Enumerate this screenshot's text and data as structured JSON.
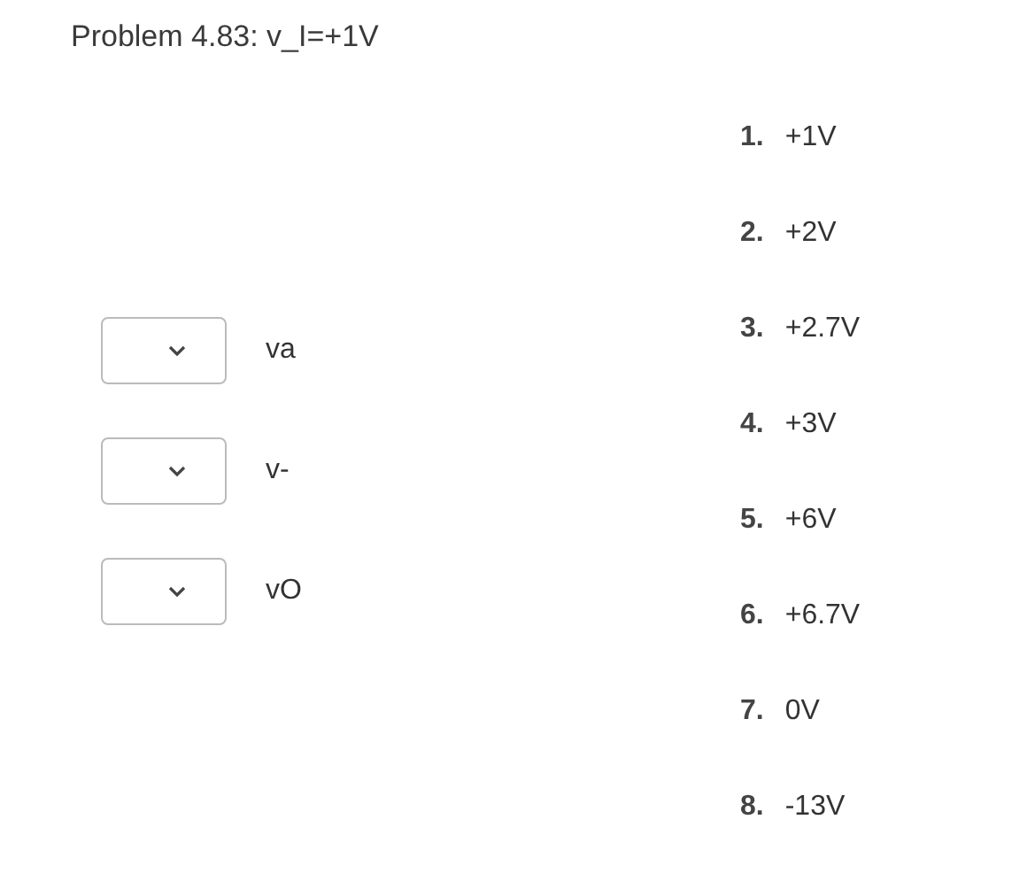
{
  "title": "Problem 4.83: v_I=+1V",
  "matches": [
    {
      "label": "va"
    },
    {
      "label": "v-"
    },
    {
      "label": "vO"
    }
  ],
  "choices": [
    {
      "number": "1.",
      "text": "+1V"
    },
    {
      "number": "2.",
      "text": "+2V"
    },
    {
      "number": "3.",
      "text": "+2.7V"
    },
    {
      "number": "4.",
      "text": "+3V"
    },
    {
      "number": "5.",
      "text": "+6V"
    },
    {
      "number": "6.",
      "text": "+6.7V"
    },
    {
      "number": "7.",
      "text": "0V"
    },
    {
      "number": "8.",
      "text": "-13V"
    }
  ]
}
